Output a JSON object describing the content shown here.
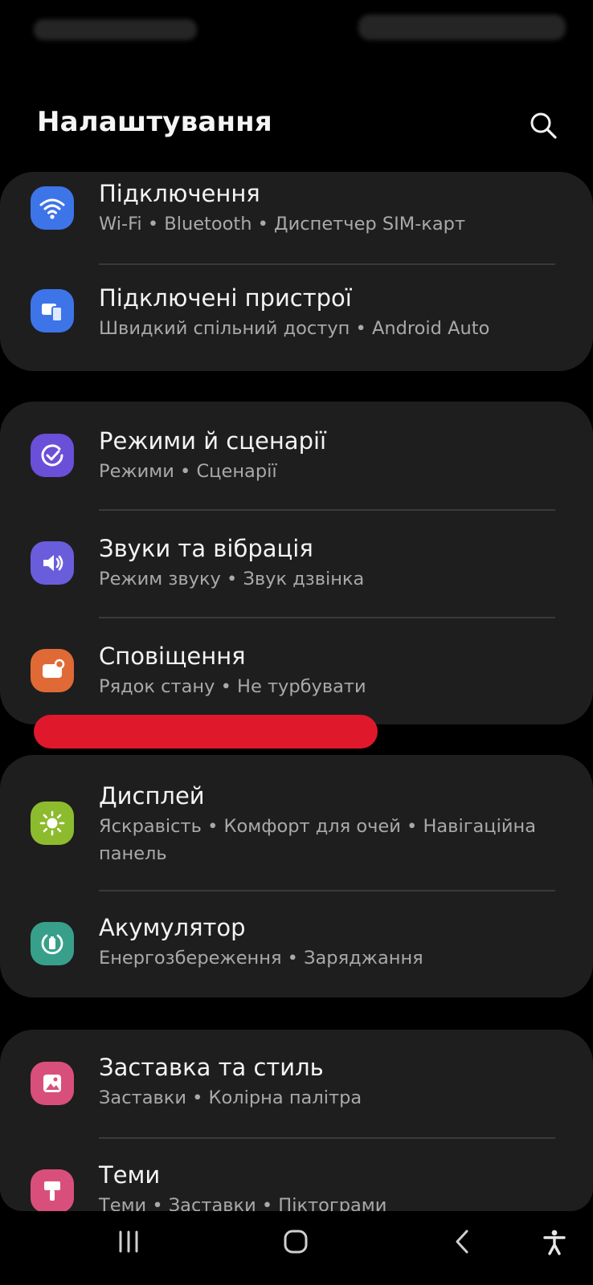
{
  "header": {
    "title": "Налаштування",
    "search_icon": "search-icon"
  },
  "colors": {
    "background": "#000000",
    "card": "#1e1e1e",
    "redaction": "#e0182b",
    "connections_icon": "#3d74e8",
    "devices_icon": "#3d74e8",
    "modes_icon": "#6a4fd8",
    "sounds_icon": "#6a5ddc",
    "notifications_icon": "#e06a35",
    "display_icon": "#8dbb2e",
    "battery_icon": "#38a08a",
    "wallpaper_icon": "#d94f7b",
    "themes_icon": "#d94f7b"
  },
  "groups": [
    {
      "items": [
        {
          "title": "Підключення",
          "subtitle": "Wi-Fi  •  Bluetooth  •  Диспетчер SIM-карт",
          "icon": "wifi-icon"
        },
        {
          "title": "Підключені пристрої",
          "subtitle": "Швидкий спільний доступ  •  Android Auto",
          "icon": "connected-devices-icon"
        }
      ]
    },
    {
      "items": [
        {
          "title": "Режими й сценарії",
          "subtitle": "Режими  •  Сценарії",
          "icon": "modes-routines-icon"
        },
        {
          "title": "Звуки та вібрація",
          "subtitle": "Режим звуку  •  Звук дзвінка",
          "icon": "speaker-icon"
        },
        {
          "title": "Сповіщення",
          "subtitle": "Рядок стану  •  Не турбувати",
          "icon": "notification-icon"
        }
      ]
    },
    {
      "items": [
        {
          "title": "Дисплей",
          "subtitle": "Яскравість  •  Комфорт для очей  •  Навігаційна панель",
          "icon": "sun-icon"
        },
        {
          "title": "Акумулятор",
          "subtitle": "Енергозбереження  •  Заряджання",
          "icon": "battery-icon"
        }
      ]
    },
    {
      "items": [
        {
          "title": "Заставка та стиль",
          "subtitle": "Заставки  •  Колірна палітра",
          "icon": "wallpaper-icon"
        },
        {
          "title": "Теми",
          "subtitle": "Теми  •  Заставки  •  Піктограми",
          "icon": "brush-icon"
        }
      ]
    }
  ],
  "navbar": {
    "recents_icon": "recents-icon",
    "home_icon": "home-icon",
    "back_icon": "back-icon",
    "accessibility_icon": "accessibility-icon"
  }
}
